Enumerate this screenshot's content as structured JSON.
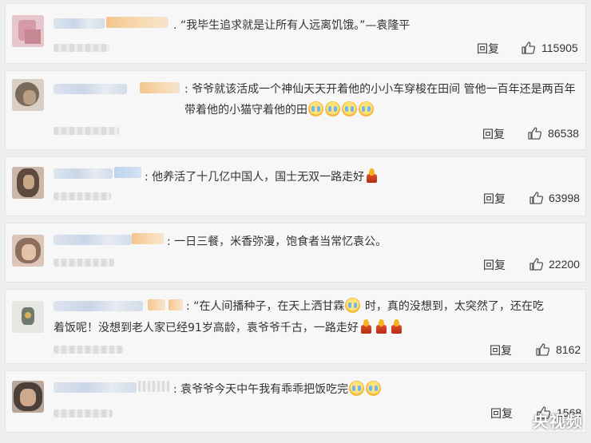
{
  "comments": [
    {
      "text": "“我毕生追求就是让所有人远离饥饿。”—袁隆平",
      "reply": "回复",
      "likes": "115905"
    },
    {
      "text": "爷爷就该活成一个神仙天天开着他的小小车穿梭在田间 管他一百年还是两百年 带着他的小猫守着他的田",
      "reply": "回复",
      "likes": "86538"
    },
    {
      "text": "他养活了十几亿中国人，国士无双一路走好",
      "reply": "回复",
      "likes": "63998"
    },
    {
      "text": "一日三餐，米香弥漫，饱食者当常忆袁公。",
      "reply": "回复",
      "likes": "22200"
    },
    {
      "text_a": "“在人间播种子，在天上洒甘霖",
      "text_b": "时，真的没想到，太突然了，还在吃",
      "text_c": "着饭呢！没想到老人家已经91岁高龄，袁爷爷千古，一路走好",
      "reply": "回复",
      "likes": "8162"
    },
    {
      "text": "袁爷爷今天中午我有乖乖把饭吃完",
      "reply": "回复",
      "likes": "1568"
    }
  ],
  "icons": {
    "like": "thumbs-up-icon",
    "cry": "crying-emoji-icon",
    "candle": "candle-emoji-icon"
  },
  "watermark": "央视频"
}
